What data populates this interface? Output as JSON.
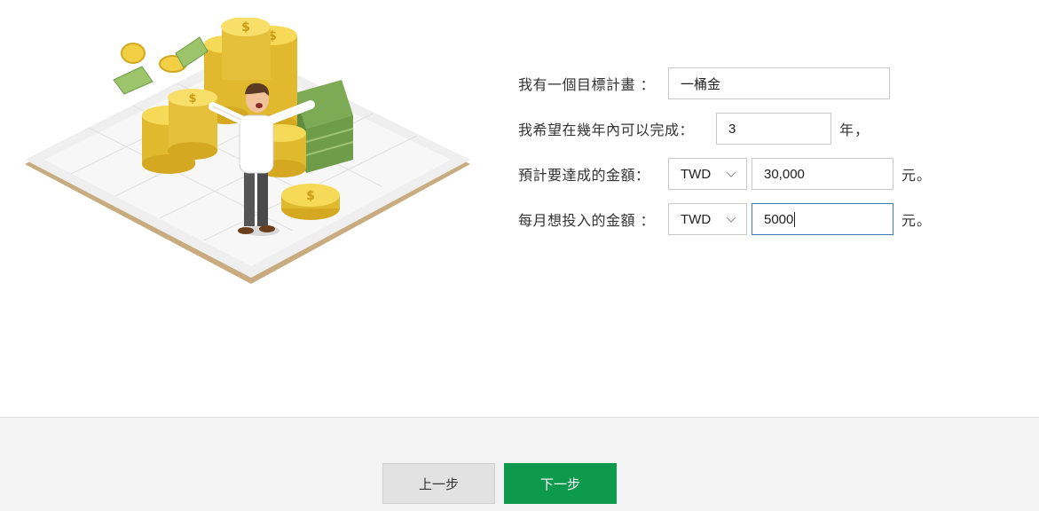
{
  "form": {
    "goal": {
      "label": "我有一個目標計畫 ：",
      "value": "一桶金"
    },
    "years": {
      "label": "我希望在幾年內可以完成：",
      "value": "3",
      "suffix": "年，"
    },
    "target": {
      "label": "預計要達成的金額：",
      "currency": "TWD",
      "value": "30,000",
      "suffix": "元。"
    },
    "monthly": {
      "label": "每月想投入的金額 ：",
      "currency": "TWD",
      "value": "5000",
      "suffix": "元。"
    }
  },
  "buttons": {
    "prev": "上一步",
    "next": "下一步"
  },
  "colors": {
    "primary": "#0e9a4d",
    "focus_border": "#3d7bb5",
    "footer_bg": "#f3f3f3"
  },
  "illustration": {
    "icon": "money-goal-illustration"
  }
}
